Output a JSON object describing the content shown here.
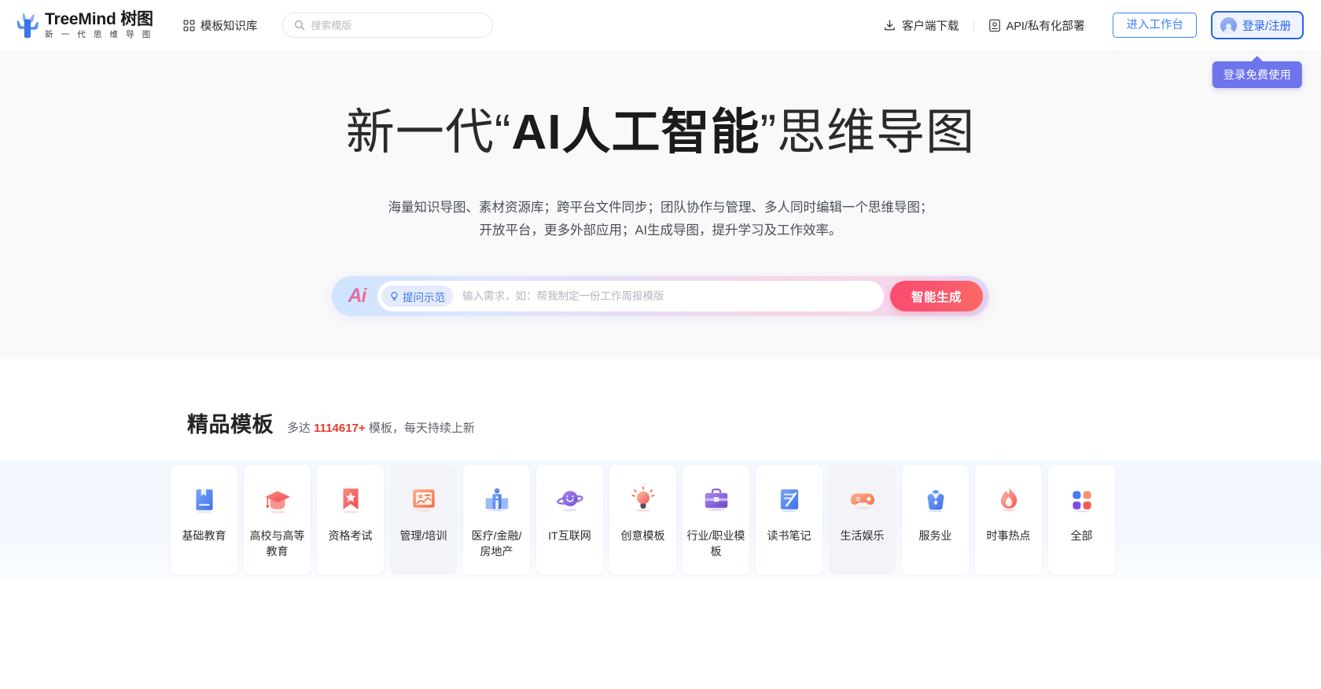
{
  "header": {
    "logo": {
      "icon": "tree-logo-icon",
      "title": "TreeMind 树图",
      "subtitle": "新 一 代 思 维 导 图"
    },
    "nav_knowledge_base": {
      "icon": "grid-icon",
      "label": "模板知识库"
    },
    "search": {
      "icon": "search-icon",
      "placeholder": "搜索模版",
      "value": ""
    },
    "client_download": {
      "icon": "download-icon",
      "label": "客户端下载"
    },
    "api_deploy": {
      "icon": "server-icon",
      "label": "API/私有化部署"
    },
    "workspace_button": "进入工作台",
    "login_button": {
      "icon": "avatar-icon",
      "label": "登录/注册"
    },
    "tooltip": "登录免费使用"
  },
  "hero": {
    "title_prefix": "新一代“",
    "title_bold": "AI人工智能",
    "title_suffix": "”思维导图",
    "subtitle_line1": "海量知识导图、素材资源库；跨平台文件同步；团队协作与管理、多人同时编辑一个思维导图；",
    "subtitle_line2": "开放平台，更多外部应用；AI生成导图，提升学习及工作效率。",
    "ai_bar": {
      "logo_text": "Ai",
      "demo_icon": "lightbulb-icon",
      "demo_label": "提问示范",
      "input_placeholder": "输入需求，如：帮我制定一份工作周报模版",
      "input_value": "",
      "generate_button": "智能生成"
    }
  },
  "templates": {
    "section_title": "精品模板",
    "desc_prefix": "多达 ",
    "desc_count": "1114617+",
    "desc_suffix": " 模板，每天持续上新",
    "cards": [
      {
        "label": "基础教育",
        "icon": "book-icon",
        "hover": false
      },
      {
        "label": "高校与高等教育",
        "icon": "graduation-cap-icon",
        "hover": false
      },
      {
        "label": "资格考试",
        "icon": "ribbon-star-icon",
        "hover": false
      },
      {
        "label": "管理/培训",
        "icon": "presentation-icon",
        "hover": true
      },
      {
        "label": "医疗/金融/房地产",
        "icon": "building-icon",
        "hover": false
      },
      {
        "label": "IT互联网",
        "icon": "planet-icon",
        "hover": false
      },
      {
        "label": "创意模板",
        "icon": "lightbulb-icon",
        "hover": false
      },
      {
        "label": "行业/职业模板",
        "icon": "briefcase-icon",
        "hover": false
      },
      {
        "label": "读书笔记",
        "icon": "notebook-pen-icon",
        "hover": false
      },
      {
        "label": "生活娱乐",
        "icon": "gamepad-icon",
        "hover": true
      },
      {
        "label": "服务业",
        "icon": "bowtie-suit-icon",
        "hover": false
      },
      {
        "label": "时事热点",
        "icon": "flame-icon",
        "hover": false
      },
      {
        "label": "全部",
        "icon": "grid-dots-icon",
        "hover": false
      }
    ]
  },
  "colors": {
    "brand_blue": "#3b82f6",
    "login_blue": "#2563eb",
    "tooltip_purple": "#6d74ec",
    "accent_red": "#e93b2e",
    "generate_pink": "#fb4d6e",
    "hero_bg": "#f9f9fa",
    "band_bg": "#f4f8ff"
  }
}
